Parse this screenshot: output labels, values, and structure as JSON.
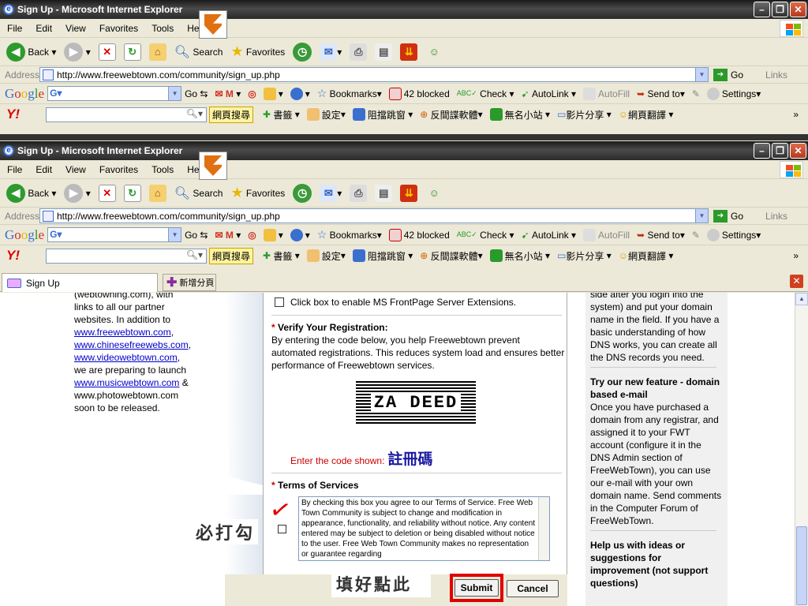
{
  "window": {
    "title": "Sign Up - Microsoft Internet Explorer",
    "partial_title": "Sign Up - Microsoft Internet Explorer"
  },
  "menu": [
    "File",
    "Edit",
    "View",
    "Favorites",
    "Tools",
    "Help"
  ],
  "toolbar": {
    "back": "Back",
    "search": "Search",
    "favorites": "Favorites"
  },
  "address": {
    "label": "Address",
    "url": "http://www.freewebtown.com/community/sign_up.php",
    "go": "Go",
    "links": "Links"
  },
  "google_bar": {
    "logo": "Google",
    "go": "Go",
    "bookmarks": "Bookmarks",
    "blocked": "42 blocked",
    "check": "Check",
    "autolink": "AutoLink",
    "autofill": "AutoFill",
    "sendto": "Send to",
    "settings": "Settings"
  },
  "yahoo_bar": {
    "logo": "Y!",
    "search_btn": "網頁搜尋",
    "book": "書籤",
    "settings": "設定",
    "block": "阻擋跳窗",
    "anti_spy": "反間諜軟體",
    "nameless": "無名小站",
    "video": "影片分享",
    "translate": "網頁翻譯"
  },
  "tabs": {
    "active": "Sign Up",
    "new_tab": "新增分頁"
  },
  "left_column": {
    "line1": "(webtowning.com), with",
    "line2": "links to all our partner",
    "line3": "websites. In addition to",
    "link1": "www.freewebtown.com",
    "link2": "www.chinesefreewebs.com",
    "link3": "www.videowebtown.com",
    "line4": "we are preparing to launch",
    "link4": "www.musicwebtown.com",
    "link4_suffix": " &",
    "line5": "www.photowebtown.com",
    "line6": "soon to be released."
  },
  "form": {
    "frontpage_label": "Click box to enable MS FrontPage Server Extensions.",
    "verify_title": "Verify Your Registration:",
    "verify_text": "By entering the code below, you help Freewebtown prevent automated registrations. This reduces system load and ensures better performance of Freewebtown services.",
    "captcha_text": "ZA DEED",
    "enter_code_label": "Enter the code shown:",
    "enter_code_note": "註冊碼",
    "terms_title": "Terms of Services",
    "terms_text": "By checking this box you agree to our Terms of Service. Free Web Town Community is subject to change and modification in appearance, functionality, and reliability without notice. Any content entered may be subject to deletion or being disabled without notice to the user.  Free Web Town Community makes no representation or guarantee regarding",
    "submit": "Submit",
    "cancel": "Cancel"
  },
  "annotations": {
    "must_check": "必打勾",
    "fill_then_click": "填好點此"
  },
  "right_column": {
    "intro": "side after you login into the system) and put your domain name in the field. If you have a basic understanding of how DNS works, you can create all the DNS records you need.",
    "feature_title": "Try our new feature - domain based e-mail",
    "feature_text": "Once you have purchased a domain from any registrar, and assigned it to your FWT account (configure it in the DNS Admin section of FreeWebTown), you can use our e-mail with your own domain name. Send comments in the Computer Forum of FreeWebTown.",
    "help_title": "Help us with ideas or suggestions for improvement (not support questions)"
  },
  "colors": {
    "title_bar": "#2a2a2a",
    "annotation_red": "#e00000",
    "link": "#0000cc",
    "note_blue": "#1a1aa0"
  }
}
